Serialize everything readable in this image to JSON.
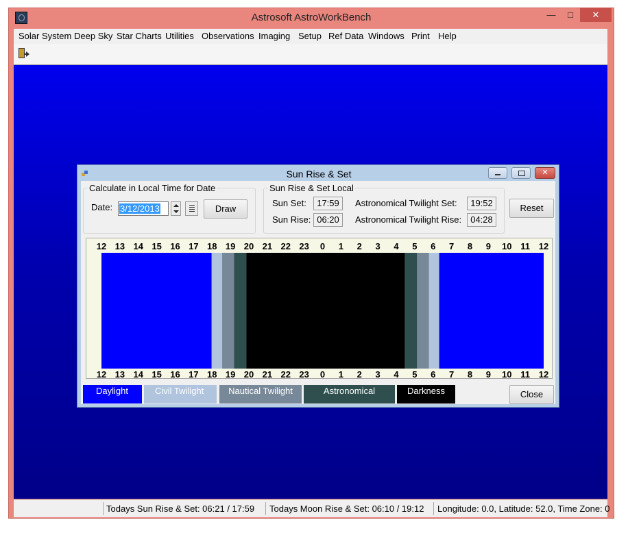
{
  "app": {
    "title": "Astrosoft AstroWorkBench",
    "minimize": "—",
    "maximize": "□",
    "close": "✕"
  },
  "menu": [
    "Solar System",
    "Deep Sky",
    "Star Charts",
    "Utilities",
    "Observations",
    "Imaging",
    "Setup",
    "Ref Data",
    "Windows",
    "Print",
    "Help"
  ],
  "toolbar": {
    "exit_icon": "door-exit-icon"
  },
  "status": {
    "sun": "Todays Sun Rise & Set: 06:21 / 17:59",
    "moon": "Todays Moon Rise & Set: 06:10 / 19:12",
    "location": "Longitude: 0.0, Latitude: 52.0, Time Zone: 0"
  },
  "dialog": {
    "title": "Sun Rise & Set",
    "icon": "app-icon",
    "calc_group": "Calculate in Local Time for Date",
    "date_label": "Date:",
    "date_value": "3/12/2013",
    "draw_label": "Draw",
    "local_group": "Sun Rise & Set Local",
    "sun_set_label": "Sun Set:",
    "sun_set_value": "17:59",
    "sun_rise_label": "Sun Rise:",
    "sun_rise_value": "06:20",
    "astro_set_label": "Astronomical Twilight Set:",
    "astro_set_value": "19:52",
    "astro_rise_label": "Astronomical Twilight Rise:",
    "astro_rise_value": "04:28",
    "reset_label": "Reset",
    "close_label": "Close"
  },
  "chart_data": {
    "type": "bar",
    "hour_labels": [
      "12",
      "13",
      "14",
      "15",
      "16",
      "17",
      "18",
      "19",
      "20",
      "21",
      "22",
      "23",
      "0",
      "1",
      "2",
      "3",
      "4",
      "5",
      "6",
      "7",
      "8",
      "9",
      "10",
      "11",
      "12"
    ],
    "band_colors": {
      "daylight": "#0000ff",
      "civil": "#b0c4de",
      "nautical": "#778899",
      "astronomical": "#2f4f4f",
      "darkness": "#000000"
    },
    "bands": [
      {
        "type": "daylight",
        "from": 0,
        "to": 5.98
      },
      {
        "type": "civil",
        "from": 5.98,
        "to": 6.55
      },
      {
        "type": "nautical",
        "from": 6.55,
        "to": 7.2
      },
      {
        "type": "astronomical",
        "from": 7.2,
        "to": 7.87
      },
      {
        "type": "darkness",
        "from": 7.87,
        "to": 16.47
      },
      {
        "type": "astronomical",
        "from": 16.47,
        "to": 17.13
      },
      {
        "type": "nautical",
        "from": 17.13,
        "to": 17.78
      },
      {
        "type": "civil",
        "from": 17.78,
        "to": 18.33
      },
      {
        "type": "daylight",
        "from": 18.33,
        "to": 24
      }
    ]
  },
  "legend": [
    {
      "label": "Daylight",
      "bg": "#0000ff",
      "fg": "#ffffff"
    },
    {
      "label": "Civil Twilight",
      "bg": "#b0c4de",
      "fg": "#ffffff"
    },
    {
      "label": "Nautical Twilight",
      "bg": "#778899",
      "fg": "#ffffff"
    },
    {
      "label": "Astronomical",
      "bg": "#2f4f4f",
      "fg": "#ffffff"
    },
    {
      "label": "Darkness",
      "bg": "#000000",
      "fg": "#ffffff"
    }
  ]
}
